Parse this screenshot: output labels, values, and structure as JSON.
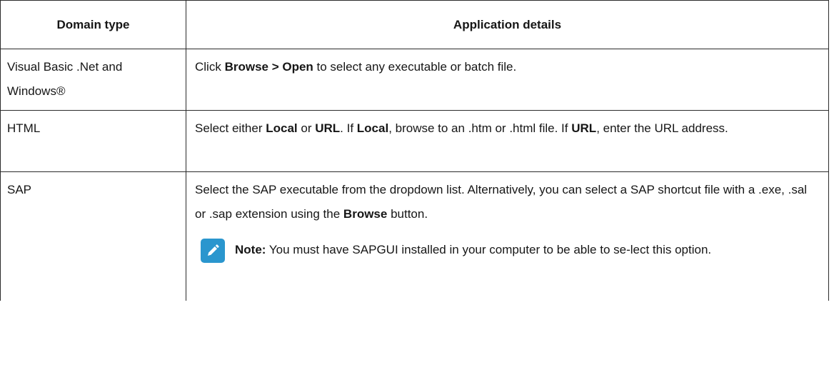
{
  "table": {
    "headers": {
      "domain_type": "Domain type",
      "application_details": "Application details"
    },
    "rows": [
      {
        "domain_type": "Visual Basic .Net and Windows®",
        "details": {
          "pre": "Click ",
          "bold1": "Browse > Open",
          "post": " to select any executable or batch file."
        }
      },
      {
        "domain_type": "HTML",
        "details": {
          "t1": "Select either ",
          "b1": "Local",
          "t2": " or ",
          "b2": "URL",
          "t3": ". If ",
          "b3": "Local",
          "t4": ", browse to an .htm or .html file. If ",
          "b4": "URL",
          "t5": ", enter the URL address."
        }
      },
      {
        "domain_type": "SAP",
        "details": {
          "t1": "Select the SAP executable from the dropdown list. Alternatively, you can select a SAP shortcut file with a .exe, .sal or .sap extension using the ",
          "b1": "Browse",
          "t2": " button.",
          "note_label": "Note:",
          "note_text": " You must have SAPGUI installed in your computer to be able to se-lect this option.",
          "note_icon": "pencil-note-icon",
          "note_icon_color": "#2a96ce"
        }
      }
    ]
  }
}
